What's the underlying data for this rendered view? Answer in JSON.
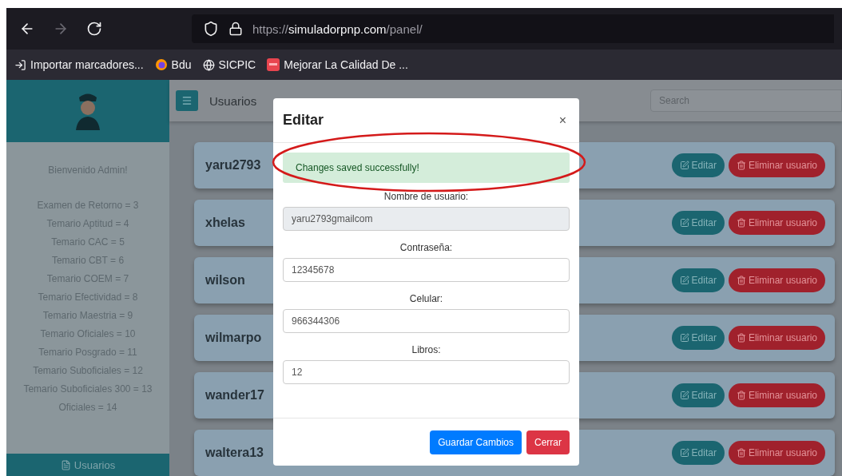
{
  "browser": {
    "nav_buttons": [
      {
        "kind": "back",
        "disabled": false
      },
      {
        "kind": "forward",
        "disabled": true
      },
      {
        "kind": "reload",
        "disabled": false
      }
    ],
    "url": {
      "scheme": "https://",
      "domain": "simuladorpnp.com",
      "path": "/panel/"
    },
    "bookmarks": [
      {
        "kind": "import",
        "label": "Importar marcadores..."
      },
      {
        "kind": "browser",
        "label": "Bdu"
      },
      {
        "kind": "globe",
        "label": "SICPIC"
      },
      {
        "kind": "app",
        "label": "Mejorar La Calidad De ..."
      }
    ]
  },
  "sidebar": {
    "welcome": "Bienvenido Admin!",
    "stats": [
      "Examen de Retorno = 3",
      "Temario Aptitud = 4",
      "Temario CAC = 5",
      "Temario CBT = 6",
      "Temario COEM = 7",
      "Temario Efectividad = 8",
      "Temario Maestria = 9",
      "Temario Oficiales = 10",
      "Temario Posgrado = 11",
      "Temario Suboficiales = 12",
      "Temario Suboficiales 300 = 13",
      "Oficiales = 14"
    ],
    "nav": [
      {
        "label": "Usuarios",
        "selected": true
      }
    ]
  },
  "topbar": {
    "title": "Usuarios",
    "search_placeholder": "Search"
  },
  "users": [
    {
      "name": "yaru2793",
      "edit": "Editar",
      "delete": "Eliminar usuario"
    },
    {
      "name": "xhelas",
      "edit": "Editar",
      "delete": "Eliminar usuario"
    },
    {
      "name": "wilson",
      "edit": "Editar",
      "delete": "Eliminar usuario"
    },
    {
      "name": "wilmarpo",
      "edit": "Editar",
      "delete": "Eliminar usuario"
    },
    {
      "name": "wander17",
      "edit": "Editar",
      "delete": "Eliminar usuario"
    },
    {
      "name": "waltera13",
      "edit": "Editar",
      "delete": "Eliminar usuario"
    }
  ],
  "modal": {
    "title": "Editar",
    "close": "×",
    "alert": "Changes saved successfully!",
    "fields": [
      {
        "label": "Nombre de usuario:",
        "value": "yaru2793gmailcom",
        "disabled": true
      },
      {
        "label": "Contraseña:",
        "value": "12345678",
        "disabled": false
      },
      {
        "label": "Celular:",
        "value": "966344306",
        "disabled": false
      },
      {
        "label": "Libros:",
        "value": "12",
        "disabled": false
      }
    ],
    "buttons": [
      {
        "kind": "primary",
        "label": "Guardar Cambios"
      },
      {
        "kind": "danger",
        "label": "Cerrar"
      }
    ]
  }
}
